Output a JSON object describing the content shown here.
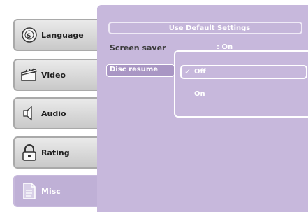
{
  "sidebar": {
    "tabs": [
      {
        "label": "Language",
        "icon": "language-globe-icon"
      },
      {
        "label": "Video",
        "icon": "video-clapper-icon"
      },
      {
        "label": "Audio",
        "icon": "audio-speaker-icon"
      },
      {
        "label": "Rating",
        "icon": "padlock-icon"
      },
      {
        "label": "Misc",
        "icon": "document-icon"
      }
    ]
  },
  "main": {
    "default_button": "Use Default Settings",
    "settings": [
      {
        "label": "Screen saver",
        "value": ": On"
      },
      {
        "label": "Disc resume"
      }
    ],
    "dropdown": {
      "options": [
        "Off",
        "On"
      ],
      "selected_check": "✓"
    }
  },
  "colors": {
    "panel": "#c7b8dc",
    "tab": "#d8d8d8"
  }
}
